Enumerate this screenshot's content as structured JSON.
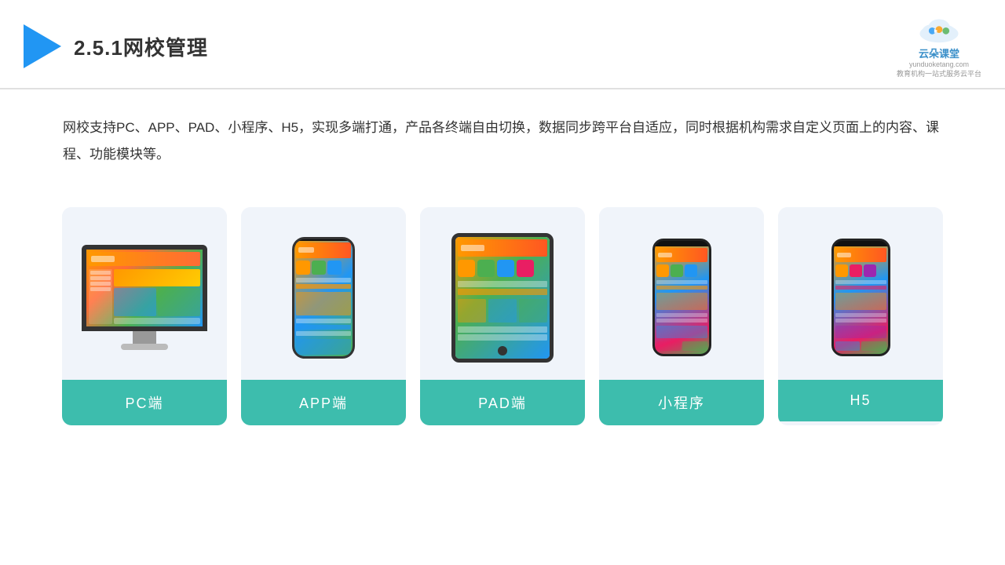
{
  "header": {
    "title": "2.5.1网校管理",
    "brand_name": "云朵课堂",
    "brand_url": "yunduoketang.com",
    "brand_slogan": "教育机构一站式服务云平台"
  },
  "description": {
    "text": "网校支持PC、APP、PAD、小程序、H5，实现多端打通，产品各终端自由切换，数据同步跨平台自适应，同时根据机构需求自定义页面上的内容、课程、功能模块等。"
  },
  "cards": [
    {
      "id": "pc",
      "label": "PC端"
    },
    {
      "id": "app",
      "label": "APP端"
    },
    {
      "id": "pad",
      "label": "PAD端"
    },
    {
      "id": "miniprogram",
      "label": "小程序"
    },
    {
      "id": "h5",
      "label": "H5"
    }
  ],
  "colors": {
    "teal": "#3dbdad",
    "accent_blue": "#2196f3",
    "bg_card": "#f0f4fa"
  }
}
